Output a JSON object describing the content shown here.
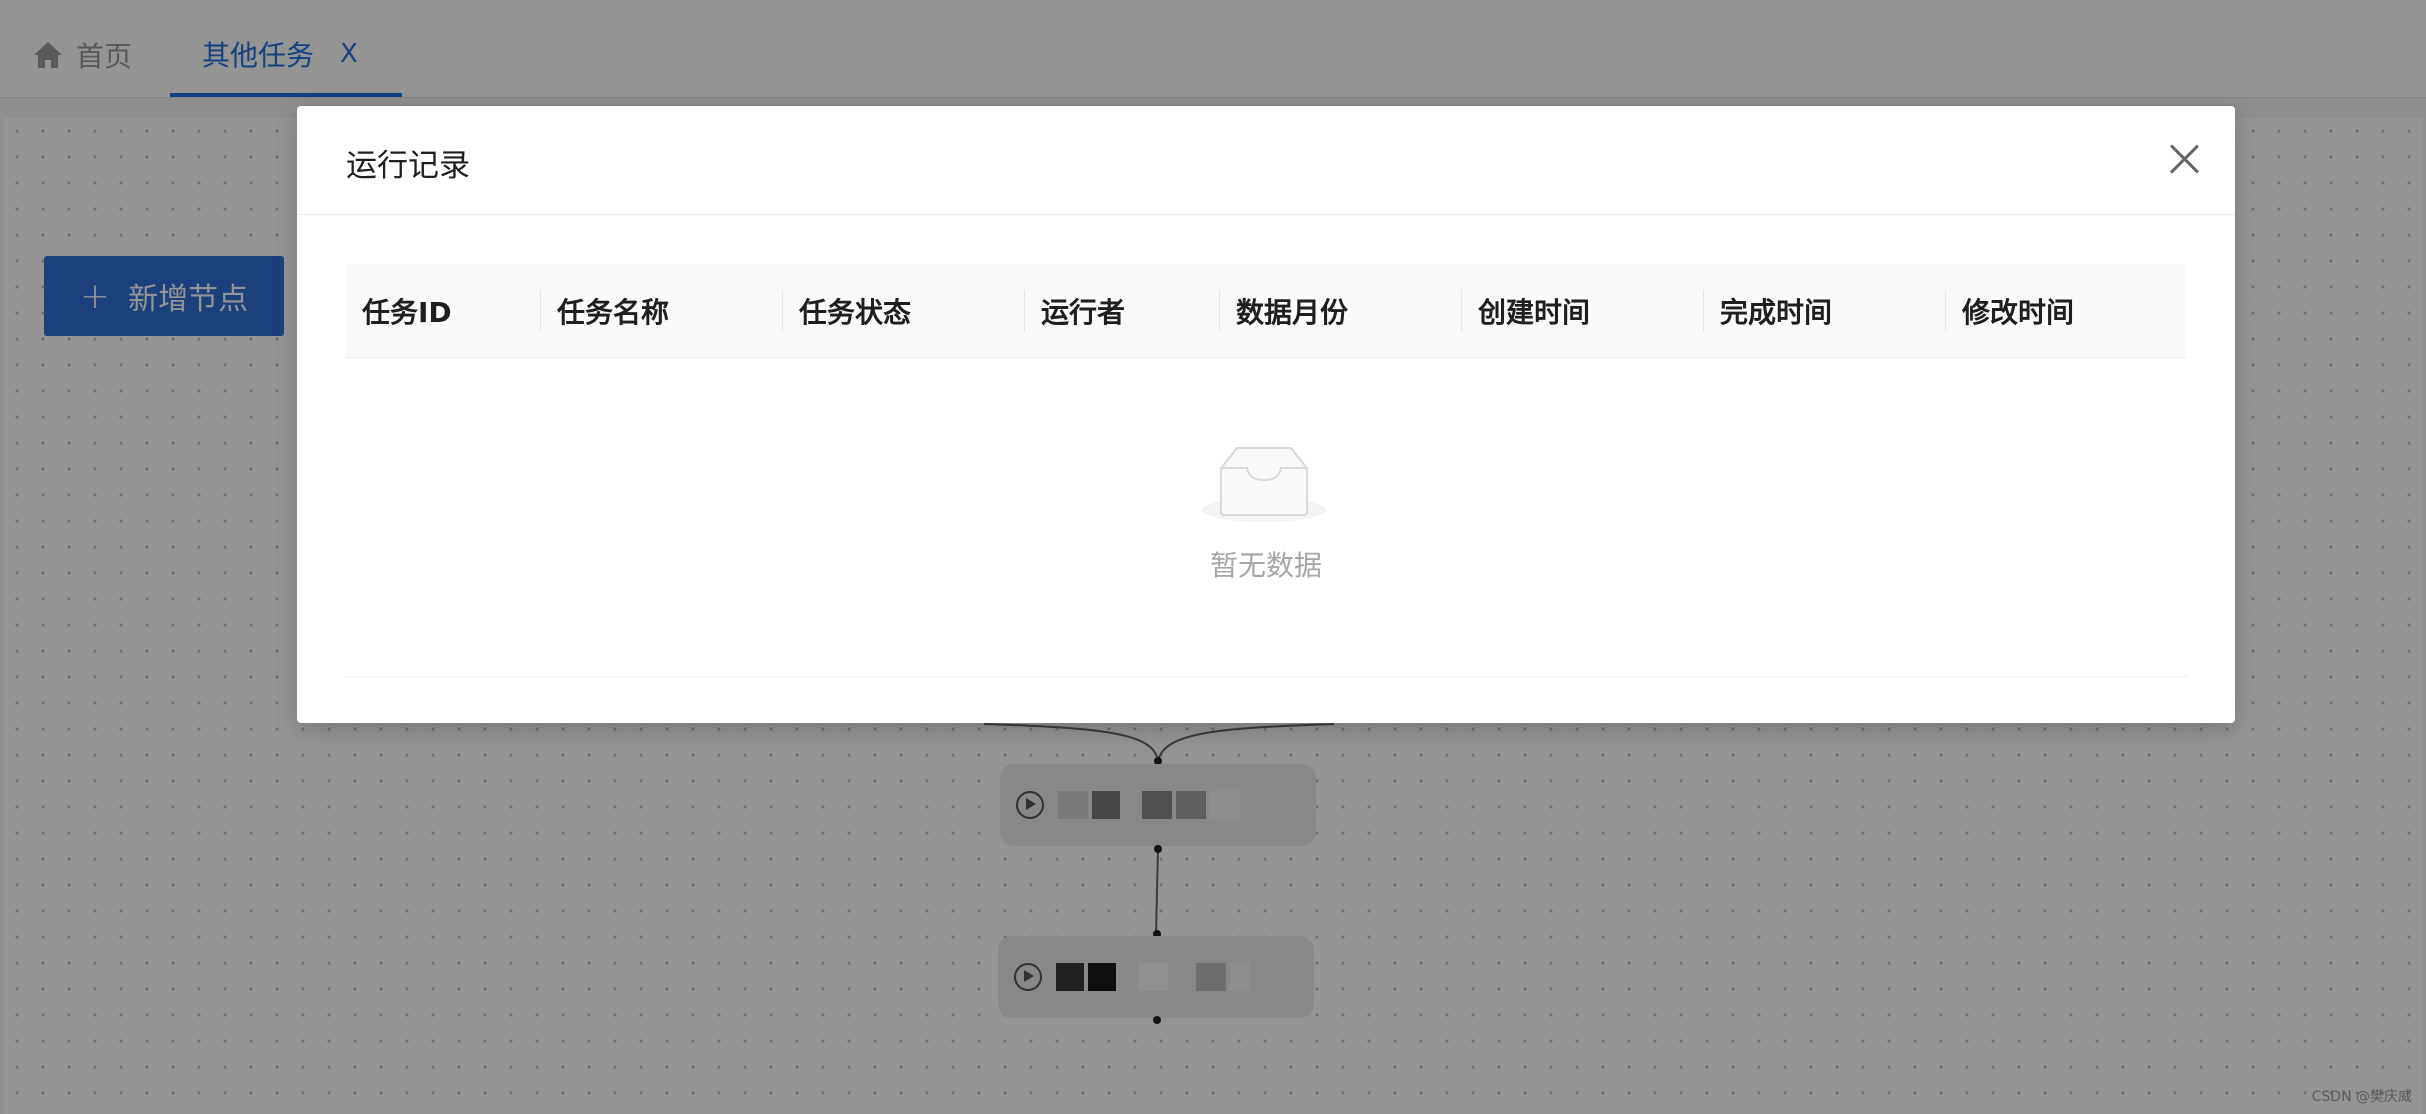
{
  "tabs": {
    "home_label": "首页",
    "active_label": "其他任务",
    "close_glyph": "X"
  },
  "toolbar": {
    "add_node_plus": "+",
    "add_node_label": "新增节点"
  },
  "dialog": {
    "title": "运行记录",
    "columns": [
      "任务ID",
      "任务名称",
      "任务状态",
      "运行者",
      "数据月份",
      "创建时间",
      "完成时间",
      "修改时间"
    ],
    "empty_text": "暂无数据"
  },
  "watermark": "CSDN @樊庆威",
  "colors": {
    "accent": "#1f6fde",
    "button": "#2f6fd6",
    "mask": "rgba(0,0,0,0.42)"
  }
}
